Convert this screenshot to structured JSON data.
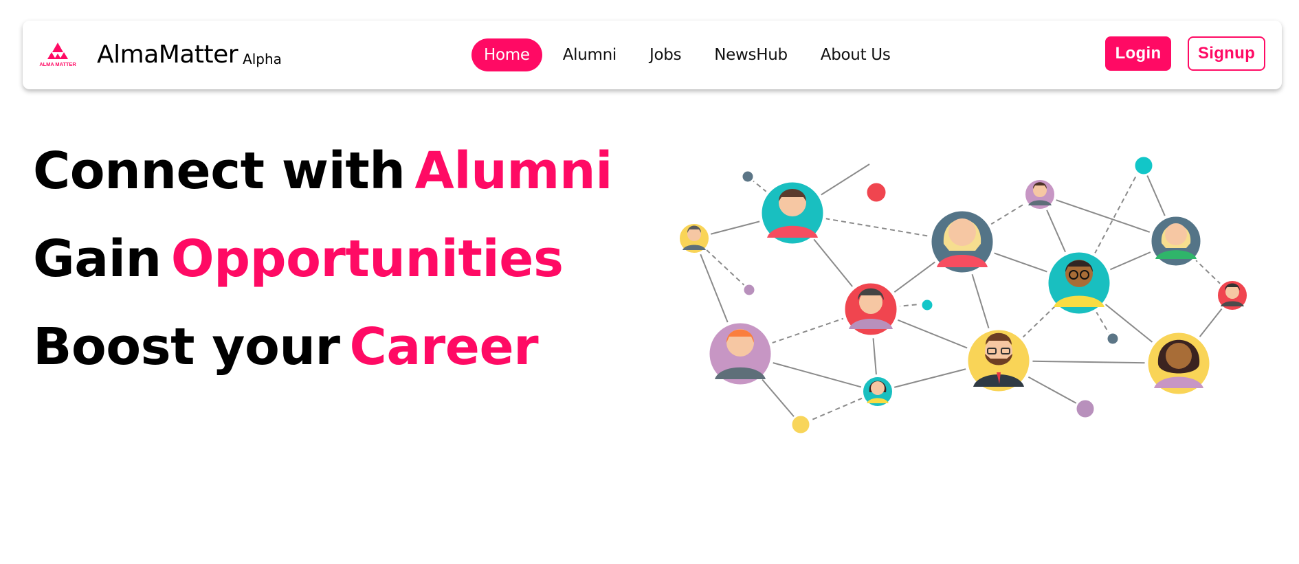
{
  "header": {
    "logo_text": "ALMA MATTER",
    "brand_name": "AlmaMatter",
    "brand_suffix": "Alpha",
    "nav": [
      {
        "label": "Home",
        "active": true
      },
      {
        "label": "Alumni",
        "active": false
      },
      {
        "label": "Jobs",
        "active": false
      },
      {
        "label": "NewsHub",
        "active": false
      },
      {
        "label": "About Us",
        "active": false
      }
    ],
    "login_label": "Login",
    "signup_label": "Signup"
  },
  "hero": {
    "lines": [
      {
        "text": "Connect with",
        "accent": "Alumni"
      },
      {
        "text": "Gain",
        "accent": "Opportunities"
      },
      {
        "text": "Boost your",
        "accent": "Career"
      }
    ]
  },
  "colors": {
    "brand": "#ff0a64",
    "text": "#000000",
    "background": "#ffffff"
  }
}
